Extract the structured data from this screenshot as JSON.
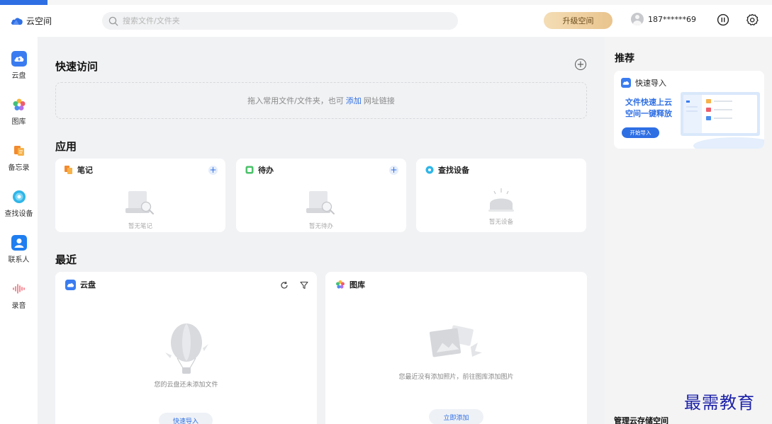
{
  "header": {
    "app_name": "云空间",
    "search_placeholder": "搜索文件/文件夹",
    "upgrade_label": "升级空间",
    "user_name": "187******69"
  },
  "sidebar": {
    "items": [
      {
        "label": "云盘",
        "icon": "cloud-drive-icon"
      },
      {
        "label": "图库",
        "icon": "gallery-icon"
      },
      {
        "label": "备忘录",
        "icon": "memo-icon"
      },
      {
        "label": "查找设备",
        "icon": "find-device-icon"
      },
      {
        "label": "联系人",
        "icon": "contacts-icon"
      },
      {
        "label": "录音",
        "icon": "recorder-icon"
      }
    ]
  },
  "quick_access": {
    "title": "快速访问",
    "drop_text_before": "拖入常用文件/文件夹，也可",
    "drop_link": "添加",
    "drop_text_after": "网址链接"
  },
  "apps": {
    "title": "应用",
    "cards": [
      {
        "name": "笔记",
        "empty": "暂无笔记"
      },
      {
        "name": "待办",
        "empty": "暂无待办"
      },
      {
        "name": "查找设备",
        "empty": "暂无设备"
      }
    ]
  },
  "recent": {
    "title": "最近",
    "drive": {
      "name": "云盘",
      "empty": "您的云盘还未添加文件",
      "button": "快速导入"
    },
    "gallery": {
      "name": "图库",
      "empty": "您最近没有添加照片，前往图库添加图片",
      "button": "立即添加"
    }
  },
  "recommend": {
    "title": "推荐",
    "promo_head": "快速导入",
    "promo_line1": "文件快速上云",
    "promo_line2": "空间一键释放",
    "promo_button": "开始导入",
    "manage_label": "管理云存储空间"
  },
  "watermark": "最需教育",
  "colors": {
    "accent": "#2f6fe4",
    "upgrade_gold": "#e9c48d",
    "background": "#f1f2f4"
  }
}
